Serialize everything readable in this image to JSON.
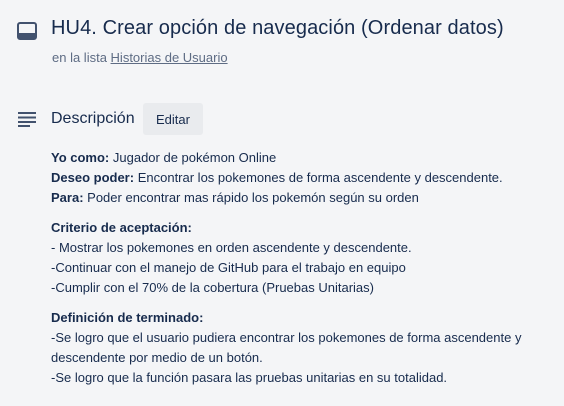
{
  "card": {
    "title": "HU4. Crear opción de navegación (Ordenar datos)",
    "list_prefix": "en la lista",
    "list_name": "Historias de Usuario"
  },
  "description": {
    "heading": "Descripción",
    "edit_label": "Editar",
    "user_story": {
      "as_label": "Yo como:",
      "as_value": "Jugador de pokémon Online",
      "want_label": "Deseo poder:",
      "want_value": "Encontrar los pokemones de forma ascendente y descendente.",
      "so_label": "Para:",
      "so_value": "Poder encontrar mas rápido los pokemón según su orden"
    },
    "acceptance": {
      "heading": "Criterio de aceptación:",
      "items": [
        "- Mostrar los pokemones en orden ascendente y descendente.",
        "-Continuar con el manejo de GitHub para el trabajo en equipo",
        "-Cumplir con el 70% de la cobertura (Pruebas Unitarias)"
      ]
    },
    "done": {
      "heading": "Definición de terminado:",
      "items": [
        "-Se logro que el usuario pudiera encontrar los pokemones de forma ascendente y descendente por medio de un botón.",
        "-Se logro que la función pasara las pruebas unitarias en su totalidad."
      ]
    }
  },
  "icons": {
    "card": "card-icon",
    "description": "description-icon"
  }
}
